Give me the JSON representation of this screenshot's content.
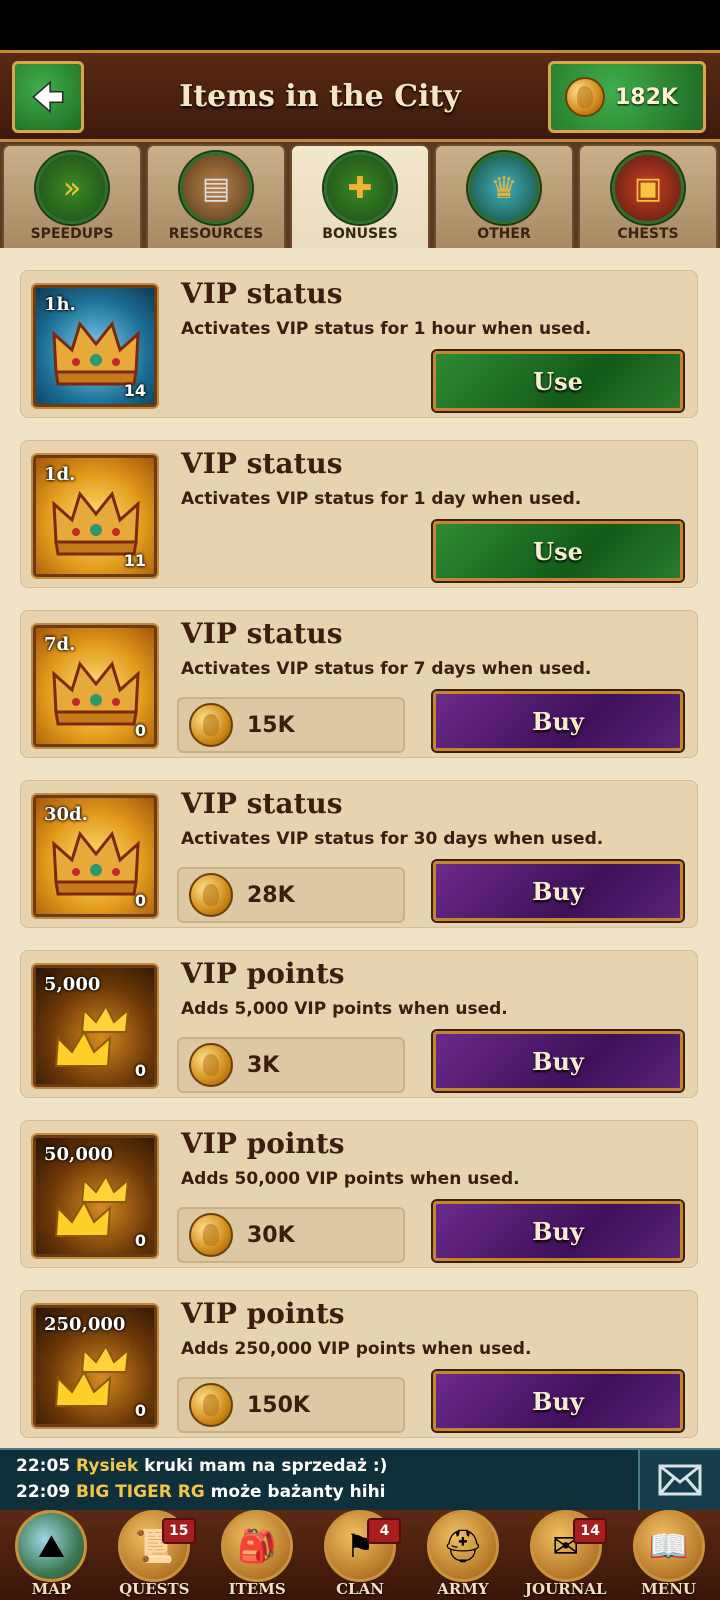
{
  "header": {
    "title": "Items in the City",
    "gold": "182K"
  },
  "tabs": [
    {
      "label": "SPEEDUPS",
      "icon": "speedup-arrows-icon"
    },
    {
      "label": "RESOURCES",
      "icon": "resources-icon"
    },
    {
      "label": "BONUSES",
      "icon": "bonus-cross-icon",
      "active": true
    },
    {
      "label": "OTHER",
      "icon": "other-items-icon"
    },
    {
      "label": "CHESTS",
      "icon": "treasure-chest-icon"
    }
  ],
  "items": [
    {
      "title": "VIP status",
      "desc": "Activates VIP status for 1 hour when used.",
      "badge": "1h.",
      "count": "14",
      "action": "Use"
    },
    {
      "title": "VIP status",
      "desc": "Activates VIP status for 1 day when used.",
      "badge": "1d.",
      "count": "11",
      "action": "Use"
    },
    {
      "title": "VIP status",
      "desc": "Activates VIP status for 7 days when used.",
      "badge": "7d.",
      "count": "0",
      "action": "Buy",
      "price": "15K"
    },
    {
      "title": "VIP status",
      "desc": "Activates VIP status for 30 days when used.",
      "badge": "30d.",
      "count": "0",
      "action": "Buy",
      "price": "28K"
    },
    {
      "title": "VIP points",
      "desc": "Adds 5,000 VIP points when used.",
      "badge": "5,000",
      "count": "0",
      "action": "Buy",
      "price": "3K"
    },
    {
      "title": "VIP points",
      "desc": "Adds 50,000 VIP points when used.",
      "badge": "50,000",
      "count": "0",
      "action": "Buy",
      "price": "30K"
    },
    {
      "title": "VIP points",
      "desc": "Adds 250,000 VIP points when used.",
      "badge": "250,000",
      "count": "0",
      "action": "Buy",
      "price": "150K"
    }
  ],
  "chat": [
    {
      "time": "22:05",
      "nick": "Rysiek",
      "text": "kruki mam na sprzedaż :)"
    },
    {
      "time": "22:09",
      "nick": "BIG TIGER RG",
      "text": "może bażanty hihi"
    }
  ],
  "nav": [
    {
      "label": "MAP"
    },
    {
      "label": "QUESTS",
      "badge": "15"
    },
    {
      "label": "ITEMS"
    },
    {
      "label": "CLAN",
      "badge": "4"
    },
    {
      "label": "ARMY"
    },
    {
      "label": "JOURNAL",
      "badge": "14"
    },
    {
      "label": "MENU"
    }
  ],
  "colors": {
    "use_button": "#1f7a28",
    "buy_button": "#4d1a6e",
    "header": "#4a2210",
    "parchment": "#efe3c8"
  }
}
